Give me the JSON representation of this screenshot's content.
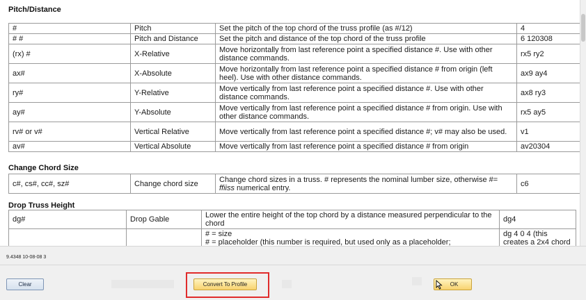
{
  "sections": {
    "pitch": {
      "title": "Pitch/Distance",
      "rows": [
        {
          "code": "#",
          "name": "Pitch",
          "description": "Set the pitch of the top chord of the truss profile (as #/12)",
          "example": "4"
        },
        {
          "code": "#   #",
          "name": "Pitch and Distance",
          "description": "Set the pitch and distance of the top chord of the truss profile",
          "example": "6   120308"
        },
        {
          "code": "(rx) #",
          "name": "X-Relative",
          "description": "Move horizontally from last reference point a specified distance #. Use with other distance commands.",
          "example": "rx5 ry2"
        },
        {
          "code": "ax#",
          "name": "X-Absolute",
          "description": "Move horizontally from last reference point a specified distance # from origin (left heel). Use with other distance commands.",
          "example": "ax9 ay4"
        },
        {
          "code": "ry#",
          "name": "Y-Relative",
          "description": "Move vertically from last reference point a specified distance #. Use with other distance commands.",
          "example": "ax8 ry3"
        },
        {
          "code": "ay#",
          "name": "Y-Absolute",
          "description": "Move vertically from last reference point a specified distance # from origin. Use with other distance commands.",
          "example": "rx5 ay5"
        },
        {
          "code": "rv# or v#",
          "name": "Vertical Relative",
          "description": "Move vertically from last reference point a specified distance #; v# may also be used.",
          "example": "v1"
        },
        {
          "code": "av#",
          "name": "Vertical Absolute",
          "description": "Move vertically from last reference point a specified distance # from origin",
          "example": "av20304"
        }
      ]
    },
    "chord": {
      "title": "Change Chord Size",
      "rows": [
        {
          "code": "c#, cs#, cc#, sz#",
          "name": "Change chord size",
          "description_part1": "Change chord sizes in a truss. # represents the nominal lumber size, otherwise #= ",
          "description_italic": "ffiiss",
          "description_part2": " numerical entry.",
          "example": "c6"
        }
      ]
    },
    "drop": {
      "title": "Drop Truss Height",
      "rows": [
        {
          "code": "dg#",
          "name": "Drop Gable",
          "description": "Lower the entire height of the top chord by a distance measured perpendicular to the chord",
          "example": "dg4"
        },
        {
          "code": "",
          "name": "",
          "description_line1": "# = size",
          "description_line2": "# = placeholder (this number is required, but used only as a placeholder;",
          "example": "dg 4 0 4 (this creates a 2x4 chord"
        }
      ]
    }
  },
  "footer": {
    "status": "9.4348 10-08-08  3",
    "clear_label": "Clear",
    "convert_label": "Convert To Profile",
    "ok_label": "OK"
  },
  "colors": {
    "highlight": "#e02b2b",
    "button_gold": "#f8d36f",
    "button_blue": "#d6e1ee"
  },
  "icons": {
    "cursor": "mouse-pointer-icon"
  }
}
